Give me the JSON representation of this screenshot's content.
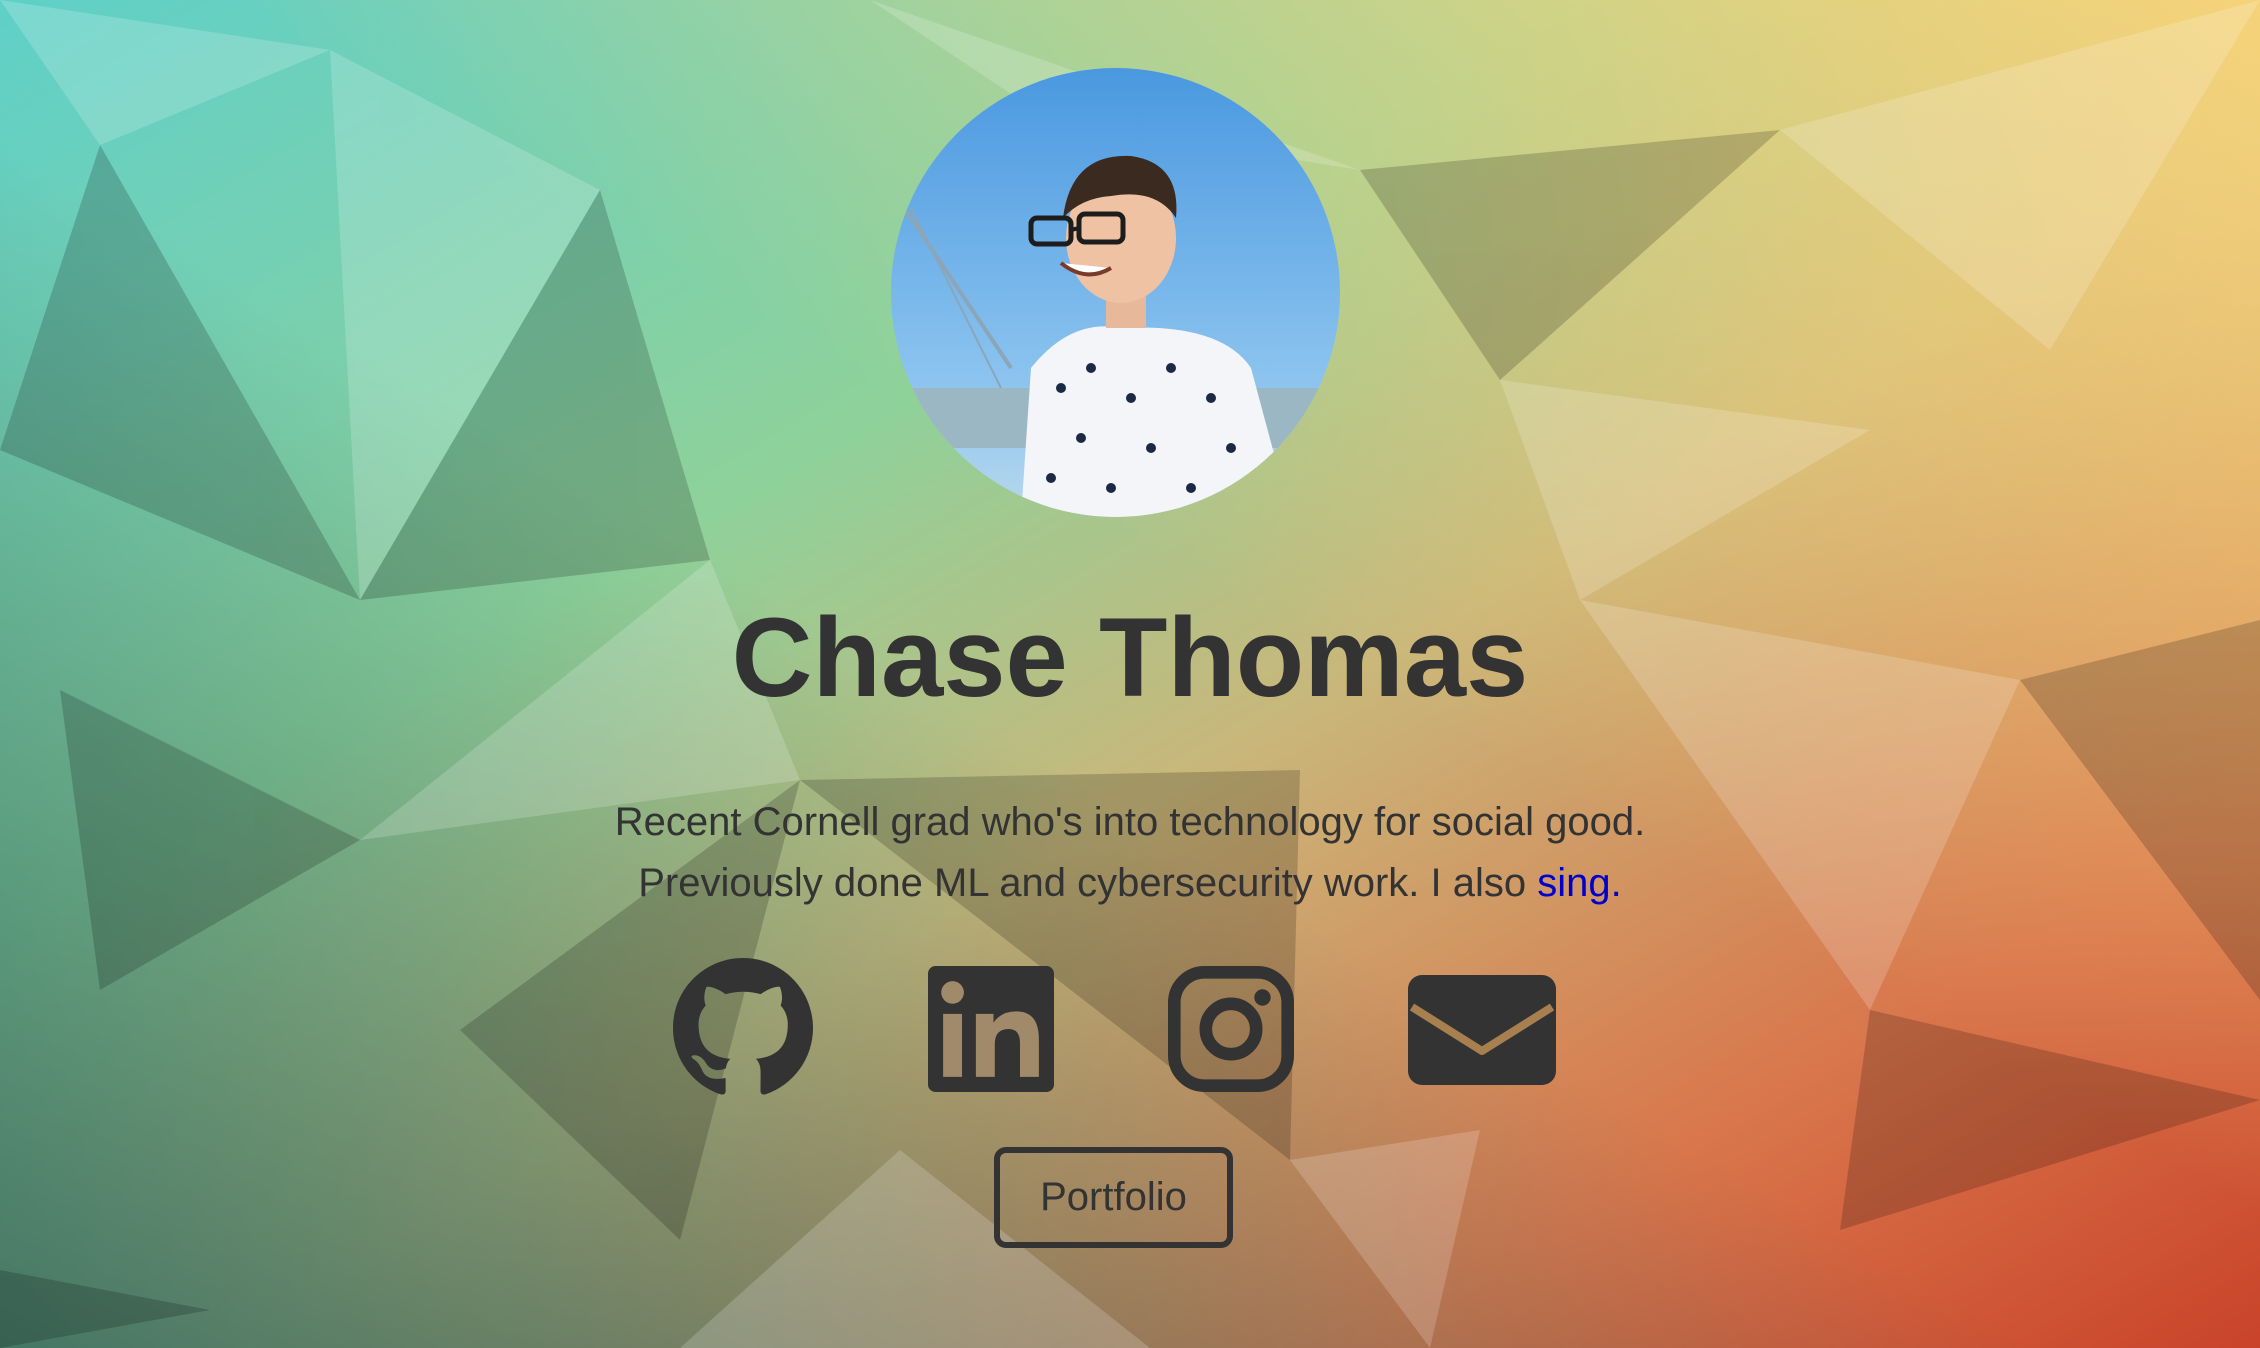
{
  "profile": {
    "name": "Chase Thomas",
    "bio_line1": "Recent Cornell grad who's into technology for social good.",
    "bio_line2_prefix": "Previously done ML and cybersecurity work. I also ",
    "bio_link": "sing."
  },
  "social_icons": [
    "github-icon",
    "linkedin-icon",
    "instagram-icon",
    "mail-icon"
  ],
  "portfolio_button": {
    "label": "Portfolio"
  },
  "colors": {
    "text": "#333333",
    "link": "#0000cc",
    "background_top_left": "#5dcfc6",
    "background_top_right": "#f7d57f",
    "background_bottom_right": "#cf4a2c",
    "background_bottom_left": "#3f6d65"
  }
}
